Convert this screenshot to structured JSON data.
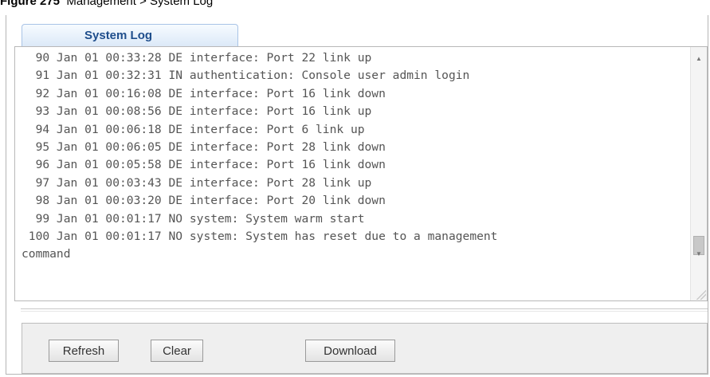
{
  "figure_caption": {
    "label": "Figure 275",
    "text": "Management > System Log"
  },
  "tab": {
    "title": "System Log"
  },
  "log": {
    "lines": [
      "  90 Jan 01 00:33:28 DE interface: Port 22 link up",
      "  91 Jan 01 00:32:31 IN authentication: Console user admin login",
      "  92 Jan 01 00:16:08 DE interface: Port 16 link down",
      "  93 Jan 01 00:08:56 DE interface: Port 16 link up",
      "  94 Jan 01 00:06:18 DE interface: Port 6 link up",
      "  95 Jan 01 00:06:05 DE interface: Port 28 link down",
      "  96 Jan 01 00:05:58 DE interface: Port 16 link down",
      "  97 Jan 01 00:03:43 DE interface: Port 28 link up",
      "  98 Jan 01 00:03:20 DE interface: Port 20 link down",
      "  99 Jan 01 00:01:17 NO system: System warm start",
      " 100 Jan 01 00:01:17 NO system: System has reset due to a management",
      "command"
    ]
  },
  "icons": {
    "scroll_up": "arrow-up-icon",
    "scroll_down": "arrow-down-icon",
    "resize": "resize-grip-icon"
  },
  "buttons": {
    "refresh": "Refresh",
    "clear": "Clear",
    "download": "Download"
  }
}
